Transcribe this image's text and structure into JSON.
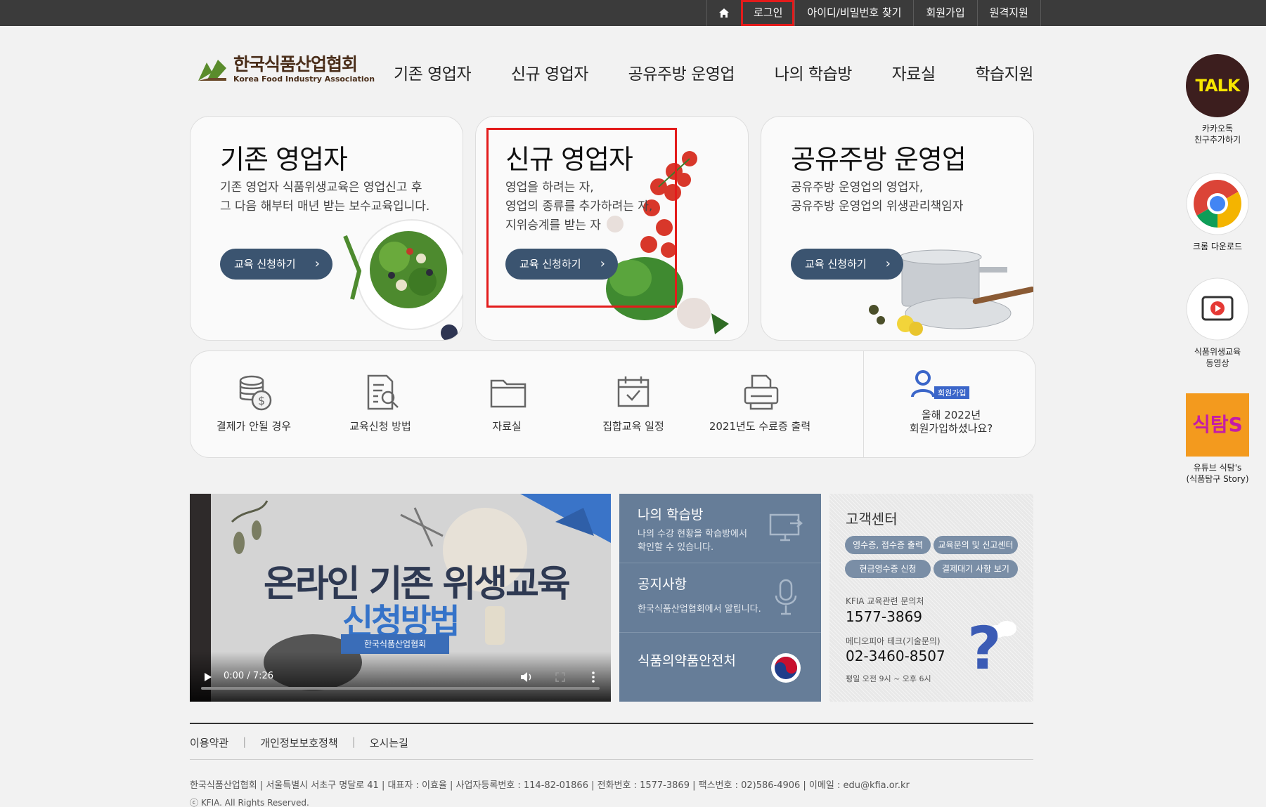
{
  "topbar": {
    "home_icon": "home-icon",
    "items": [
      "로그인",
      "아이디/비밀번호 찾기",
      "회원가입",
      "원격지원"
    ]
  },
  "logo": {
    "name_ko": "한국식품산업협회",
    "name_en": "Korea Food Industry Association"
  },
  "mainnav": [
    "기존 영업자",
    "신규 영업자",
    "공유주방 운영업",
    "나의 학습방",
    "자료실",
    "학습지원"
  ],
  "cards": [
    {
      "title": "기존 영업자",
      "desc": "기존 영업자 식품위생교육은 영업신고 후\n그 다음 해부터 매년 받는 보수교육입니다.",
      "button": "교육 신청하기"
    },
    {
      "title": "신규 영업자",
      "desc": "영업을 하려는 자,\n영업의 종류를 추가하려는 자,\n지위승계를 받는 자",
      "button": "교육 신청하기"
    },
    {
      "title": "공유주방 운영업",
      "desc": "공유주방 운영업의 영업자,\n공유주방 운영업의 위생관리책임자",
      "button": "교육 신청하기"
    }
  ],
  "quickmenu": [
    {
      "label": "결제가 안될 경우",
      "icon": "coins-icon"
    },
    {
      "label": "교육신청 방법",
      "icon": "document-search-icon"
    },
    {
      "label": "자료실",
      "icon": "folder-icon"
    },
    {
      "label": "집합교육 일정",
      "icon": "calendar-icon"
    },
    {
      "label": "2021년도 수료증 출력",
      "icon": "printer-icon"
    }
  ],
  "join": {
    "badge": "회원가입",
    "text": "올해 2022년\n회원가입하셨나요?"
  },
  "video": {
    "title_line1": "온라인 기존 위생교육",
    "title_line2": "신청방법",
    "badge": "한국식품산업협회",
    "time": "0:00 / 7:26"
  },
  "midpanel": [
    {
      "title": "나의 학습방",
      "desc": "나의 수강 현황을 학습방에서\n확인할 수 있습니다."
    },
    {
      "title": "공지사항",
      "desc": "한국식품산업협회에서 알립니다."
    },
    {
      "title": "식품의약품안전처",
      "desc": ""
    }
  ],
  "customer_center": {
    "title": "고객센터",
    "buttons": [
      "영수증, 접수증 출력",
      "교육문의 및 신고센터",
      "현금영수증 신청",
      "결제대기 사항 보기"
    ],
    "label1": "KFIA 교육관련 문의처",
    "phone1": "1577-3869",
    "label2": "메디오피아 테크(기술문의)",
    "phone2": "02-3460-8507",
    "hours": "평일 오전 9시 ~ 오후 6시",
    "question_mark": "?"
  },
  "footer": {
    "links": [
      "이용약관",
      "개인정보보호정책",
      "오시는길"
    ],
    "address": "한국식품산업협회  |  서울특별시 서초구 명달로 41  |  대표자 : 이효율  |  사업자등록번호 : 114-82-01866  |  전화번호 : 1577-3869  |  팩스번호 : 02)586-4906  |  이메일 : edu@kfia.or.kr",
    "copyright": "ⓒ KFIA. All Rights Reserved."
  },
  "rightbar": [
    {
      "label": "카카오톡\n친구추가하기",
      "icon": "kakao-talk-icon",
      "icon_text": "TALK"
    },
    {
      "label": "크롬 다운로드",
      "icon": "chrome-icon"
    },
    {
      "label": "식품위생교육\n동영상",
      "icon": "video-play-icon"
    },
    {
      "label": "유튜브 식탐's\n(식품탐구 Story)",
      "icon": "youtube-sikdam-icon",
      "icon_text": "식탐S"
    }
  ],
  "colors": {
    "topbar": "#3b3b3b",
    "accent_button": "#3b5470",
    "highlight": "#e31b1b",
    "panel": "#667d98"
  }
}
